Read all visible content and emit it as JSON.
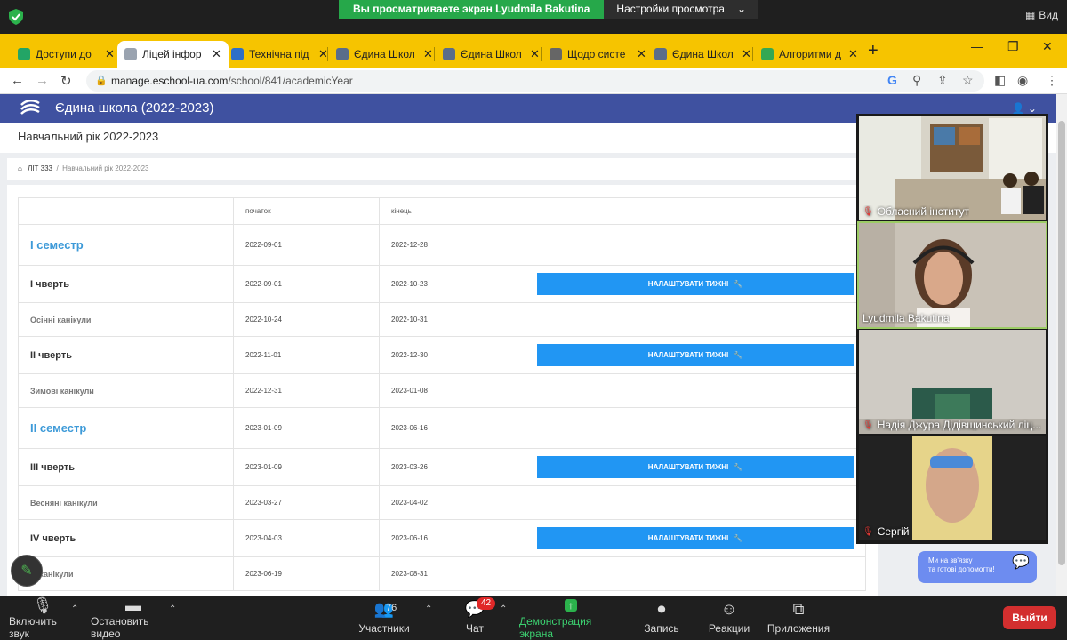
{
  "zoom_top": {
    "share_banner_text": "Вы просматриваете экран Lyudmila Bakutina",
    "view_settings_label": "Настройки просмотра",
    "view_label": "Вид"
  },
  "browser": {
    "tabs": [
      {
        "label": "Доступи до",
        "favicon_color": "#23a566",
        "active": false
      },
      {
        "label": "Ліцей інфор",
        "favicon_color": "#9aa3b0",
        "active": true
      },
      {
        "label": "Технічна під",
        "favicon_color": "#2f6fc7",
        "active": false
      },
      {
        "label": "Єдина Школ",
        "favicon_color": "#5a6d8a",
        "active": false
      },
      {
        "label": "Єдина Школ",
        "favicon_color": "#5a6d8a",
        "active": false
      },
      {
        "label": "Щодо систе",
        "favicon_color": "#666666",
        "active": false
      },
      {
        "label": "Єдина Школ",
        "favicon_color": "#5a6d8a",
        "active": false
      },
      {
        "label": "Алгоритми д",
        "favicon_color": "#34a853",
        "active": false
      }
    ],
    "url_domain": "manage.eschool-ua.com",
    "url_path": "/school/841/academicYear"
  },
  "app": {
    "title": "Єдина школа (2022-2023)",
    "page_title": "Навчальний рік 2022-2023",
    "breadcrumb": {
      "root": "ЛІТ 333",
      "current": "Навчальний рік 2022-2023"
    },
    "table": {
      "headers": [
        "",
        "початок",
        "кінець",
        ""
      ],
      "button_label": "НАЛАШТУВАТИ ТИЖНІ",
      "rows": [
        {
          "name": "І семестр",
          "kind": "sem",
          "start": "2022-09-01",
          "end": "2022-12-28",
          "button": false
        },
        {
          "name": "І чверть",
          "kind": "qtr",
          "start": "2022-09-01",
          "end": "2022-10-23",
          "button": true
        },
        {
          "name": "Осінні канікули",
          "kind": "hol",
          "start": "2022-10-24",
          "end": "2022-10-31",
          "button": false
        },
        {
          "name": "ІІ чверть",
          "kind": "qtr",
          "start": "2022-11-01",
          "end": "2022-12-30",
          "button": true
        },
        {
          "name": "Зимові канікули",
          "kind": "hol",
          "start": "2022-12-31",
          "end": "2023-01-08",
          "button": false
        },
        {
          "name": "ІІ семестр",
          "kind": "sem",
          "start": "2023-01-09",
          "end": "2023-06-16",
          "button": false
        },
        {
          "name": "ІІІ чверть",
          "kind": "qtr",
          "start": "2023-01-09",
          "end": "2023-03-26",
          "button": true
        },
        {
          "name": "Весняні канікули",
          "kind": "hol",
          "start": "2023-03-27",
          "end": "2023-04-02",
          "button": false
        },
        {
          "name": "IV чверть",
          "kind": "qtr",
          "start": "2023-04-03",
          "end": "2023-06-16",
          "button": true
        },
        {
          "name": "ні канікули",
          "kind": "hol",
          "start": "2023-06-19",
          "end": "2023-08-31",
          "button": false
        }
      ]
    }
  },
  "participants": [
    {
      "name": "Обласний інститут",
      "muted": true
    },
    {
      "name": "Lyudmila Bakutina",
      "muted": false
    },
    {
      "name": "Надія Джура Дідівщинський ліц...",
      "muted": true
    },
    {
      "name": "Сергій",
      "muted": true
    }
  ],
  "help_chip": {
    "line1": "Ми на зв'язку",
    "line2": "та готові допомогти!"
  },
  "zoom_bottom": {
    "unmute": "Включить звук",
    "stop_video": "Остановить видео",
    "participants": "Участники",
    "participants_count": "76",
    "chat": "Чат",
    "chat_badge": "42",
    "share": "Демонстрация экрана",
    "record": "Запись",
    "reactions": "Реакции",
    "apps": "Приложения",
    "leave": "Выйти"
  }
}
